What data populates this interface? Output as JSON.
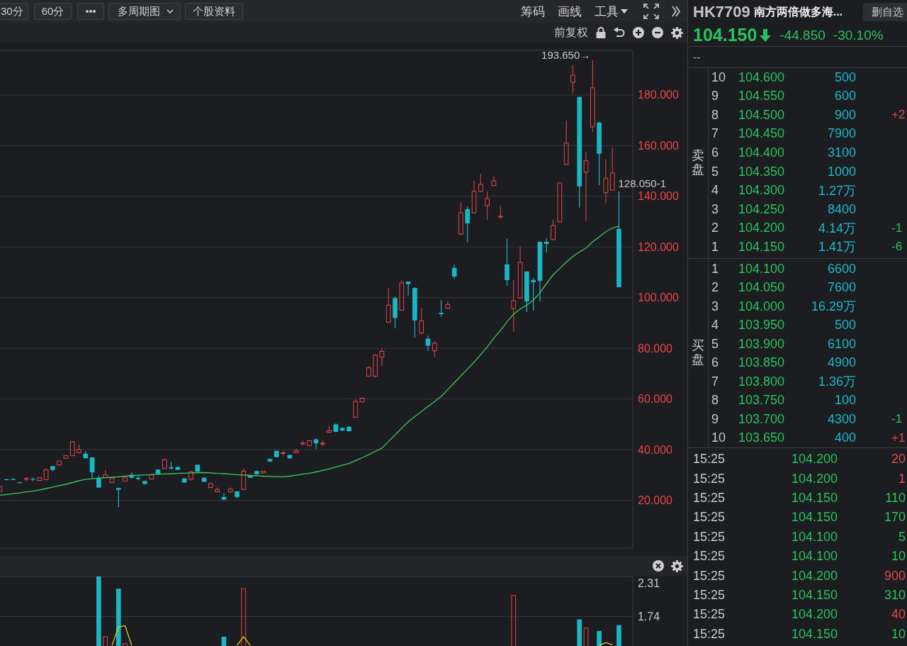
{
  "toolbar": {
    "left_buttons": [
      {
        "kind": "button",
        "label": "30分"
      },
      {
        "kind": "button",
        "label": "60分"
      },
      {
        "kind": "more"
      },
      {
        "kind": "dropdown",
        "label": "多周期图"
      },
      {
        "kind": "button",
        "label": "个股资料"
      }
    ],
    "right_items": [
      {
        "kind": "text",
        "label": "筹码"
      },
      {
        "kind": "text",
        "label": "画线"
      },
      {
        "kind": "menu",
        "label": "工具"
      }
    ]
  },
  "chart_toolbar": {
    "adjust_label": "前复权"
  },
  "chart": {
    "chart_data": [
      {
        "type": "candlestick",
        "ylim": [
          1.1,
          197.6
        ],
        "yticks": [
          {
            "value": 20,
            "label": "20.000"
          },
          {
            "value": 40,
            "label": "40.000"
          },
          {
            "value": 60,
            "label": "60.000"
          },
          {
            "value": 80,
            "label": "80.000"
          },
          {
            "value": 100,
            "label": "100.000"
          },
          {
            "value": 120,
            "label": "120.000"
          },
          {
            "value": 140,
            "label": "140.000"
          },
          {
            "value": 160,
            "label": "160.000"
          },
          {
            "value": 180,
            "label": "180.000"
          }
        ],
        "grid": true,
        "ohlc": [
          [
            23.6,
            25.6,
            23.4,
            25.4
          ],
          [
            28.3,
            28.5,
            27.9,
            28.0
          ],
          [
            28.4,
            28.6,
            28.0,
            28.1
          ],
          [
            27.1,
            27.3,
            26.8,
            27.0
          ],
          [
            28.3,
            29.1,
            27.6,
            28.6
          ],
          [
            28.4,
            29.1,
            27.5,
            28.1
          ],
          [
            27.8,
            29.0,
            27.6,
            28.9
          ],
          [
            28.1,
            32.4,
            28.0,
            32.1
          ],
          [
            33.5,
            33.6,
            31.5,
            32.0
          ],
          [
            33.9,
            35.6,
            33.8,
            35.5
          ],
          [
            36.5,
            37.8,
            36.3,
            37.6
          ],
          [
            37.6,
            43.3,
            37.5,
            43.1
          ],
          [
            38.8,
            42.0,
            38.6,
            40.0
          ],
          [
            38.4,
            39.5,
            36.5,
            36.6
          ],
          [
            36.9,
            37.0,
            28.8,
            31.0
          ],
          [
            28.8,
            29.8,
            24.8,
            25.0
          ],
          [
            29.0,
            32.0,
            28.8,
            30.0
          ],
          [
            27.0,
            29.0,
            26.8,
            28.8
          ],
          [
            24.8,
            25.0,
            17.3,
            24.1
          ],
          [
            27.5,
            29.2,
            27.4,
            29.1
          ],
          [
            30.1,
            31.0,
            28.5,
            28.9
          ],
          [
            28.9,
            29.8,
            27.9,
            28.4
          ],
          [
            27.6,
            27.8,
            26.2,
            26.4
          ],
          [
            28.4,
            30.4,
            28.2,
            30.0
          ],
          [
            32.1,
            32.3,
            30.0,
            30.3
          ],
          [
            32.5,
            36.3,
            32.3,
            36.0
          ],
          [
            33.0,
            35.1,
            32.2,
            32.6
          ],
          [
            33.1,
            33.5,
            31.9,
            32.0
          ],
          [
            28.6,
            28.9,
            26.9,
            27.0
          ],
          [
            28.3,
            31.5,
            27.9,
            31.3
          ],
          [
            34.0,
            34.2,
            31.0,
            31.3
          ],
          [
            28.9,
            29.0,
            27.1,
            27.3
          ],
          [
            25.0,
            26.9,
            24.9,
            26.6
          ],
          [
            23.3,
            25.0,
            23.1,
            24.3
          ],
          [
            21.3,
            22.8,
            20.0,
            20.3
          ],
          [
            23.3,
            25.0,
            23.1,
            24.4
          ],
          [
            23.5,
            23.6,
            20.8,
            21.3
          ],
          [
            24.3,
            32.5,
            24.0,
            31.5
          ],
          [
            29.8,
            30.0,
            28.8,
            28.9
          ],
          [
            31.5,
            31.8,
            30.1,
            30.3
          ],
          [
            30.8,
            31.6,
            30.6,
            31.5
          ],
          [
            36.3,
            36.5,
            35.1,
            35.3
          ],
          [
            39.5,
            39.6,
            36.9,
            37.0
          ],
          [
            38.5,
            39.5,
            37.5,
            38.8
          ],
          [
            37.9,
            38.0,
            36.4,
            36.6
          ],
          [
            38.8,
            40.3,
            38.6,
            39.5
          ],
          [
            42.4,
            43.5,
            41.6,
            42.6
          ],
          [
            41.6,
            43.8,
            41.4,
            43.5
          ],
          [
            44.0,
            44.5,
            40.3,
            42.5
          ],
          [
            42.3,
            43.5,
            41.3,
            42.5
          ],
          [
            46.8,
            49.3,
            46.6,
            47.5
          ],
          [
            50.0,
            50.3,
            46.9,
            47.0
          ],
          [
            48.5,
            48.8,
            47.3,
            47.5
          ],
          [
            49.0,
            49.3,
            47.0,
            47.3
          ],
          [
            52.8,
            59.8,
            52.5,
            59.0
          ],
          [
            58.8,
            60.5,
            58.6,
            60.3
          ],
          [
            69.0,
            73.0,
            68.8,
            72.3
          ],
          [
            69.0,
            77.8,
            68.5,
            77.3
          ],
          [
            76.5,
            80.0,
            73.0,
            78.8
          ],
          [
            90.3,
            103.8,
            90.0,
            97.0
          ],
          [
            99.8,
            100.5,
            87.9,
            92.0
          ],
          [
            95.0,
            107.0,
            94.8,
            105.8
          ],
          [
            106.3,
            106.5,
            100.8,
            105.3
          ],
          [
            103.8,
            104.0,
            84.3,
            91.0
          ],
          [
            86.0,
            96.0,
            85.8,
            90.8
          ],
          [
            83.8,
            85.0,
            79.0,
            81.0
          ],
          [
            79.0,
            82.9,
            76.4,
            82.0
          ],
          [
            94.0,
            99.0,
            92.5,
            93.5
          ],
          [
            95.8,
            98.5,
            95.6,
            97.3
          ],
          [
            111.7,
            113.0,
            107.5,
            108.3
          ],
          [
            125.1,
            137.7,
            124.5,
            133.5
          ],
          [
            134.9,
            136.0,
            121.8,
            129.3
          ],
          [
            133.5,
            146.1,
            133.3,
            141.9
          ],
          [
            141.9,
            148.9,
            141.7,
            144.7
          ],
          [
            136.3,
            141.9,
            130.7,
            139.1
          ],
          [
            144.2,
            148.0,
            144.0,
            146.1
          ],
          [
            131.8,
            136.3,
            131.3,
            132.1
          ],
          [
            113.1,
            123.2,
            104.7,
            106.9
          ],
          [
            95.7,
            106.9,
            86.5,
            98.8
          ],
          [
            99.9,
            120.1,
            99.5,
            113.9
          ],
          [
            110.3,
            110.5,
            94.3,
            98.5
          ],
          [
            106.9,
            107.8,
            94.9,
            106.1
          ],
          [
            122.0,
            122.2,
            98.5,
            106.6
          ],
          [
            122.0,
            123.4,
            117.8,
            121.2
          ],
          [
            122.9,
            130.7,
            122.7,
            128.5
          ],
          [
            129.9,
            145.6,
            129.7,
            145.3
          ],
          [
            152.6,
            169.9,
            152.4,
            161.0
          ],
          [
            185.0,
            191.8,
            180.8,
            187.8
          ],
          [
            179.2,
            179.5,
            135.5,
            143.9
          ],
          [
            149.5,
            157.6,
            130.2,
            154.0
          ],
          [
            167.4,
            193.65,
            165.4,
            182.8
          ],
          [
            169.1,
            169.3,
            144.4,
            156.8
          ],
          [
            141.4,
            154.5,
            137.2,
            147.0
          ],
          [
            142.5,
            159.3,
            142.3,
            149.2
          ],
          [
            127.1,
            141.9,
            104.15,
            104.15
          ]
        ],
        "series": [
          {
            "type": "line",
            "color": "#3ec95c",
            "values": [
              22.0,
              22.3,
              22.6,
              22.9,
              23.3,
              23.6,
              24.1,
              24.6,
              25.2,
              25.8,
              26.3,
              27.0,
              27.7,
              28.3,
              28.5,
              28.7,
              28.9,
              29.1,
              29.3,
              29.5,
              29.7,
              29.9,
              30.0,
              30.1,
              30.3,
              30.4,
              30.5,
              30.6,
              30.7,
              30.8,
              30.9,
              30.9,
              30.8,
              30.6,
              30.5,
              30.3,
              30.1,
              30.0,
              29.8,
              29.7,
              29.5,
              29.4,
              29.3,
              29.3,
              29.5,
              29.9,
              30.3,
              30.7,
              31.2,
              31.8,
              32.4,
              33.1,
              33.8,
              34.5,
              35.6,
              36.8,
              38.0,
              39.3,
              40.6,
              43.2,
              45.8,
              48.4,
              51.0,
              53.0,
              55.0,
              57.0,
              59.0,
              61.0,
              63.7,
              66.4,
              69.1,
              71.8,
              74.5,
              77.5,
              80.5,
              84.0,
              87.0,
              90.5,
              93.5,
              95.5,
              97.0,
              99.0,
              101.9,
              105.5,
              109.0,
              111.5,
              114.0,
              116.2,
              118.0,
              119.5,
              122.0,
              124.0,
              126.0,
              127.4,
              128.2
            ]
          }
        ],
        "annotations": [
          "193.650→",
          "128.050-1"
        ]
      },
      {
        "type": "bar",
        "categories": [
          null,
          null,
          null,
          null,
          null,
          null,
          null,
          null,
          null,
          null,
          null,
          null,
          null,
          null,
          null,
          null,
          null,
          null,
          null,
          null,
          null,
          null,
          null,
          null,
          null,
          null,
          null,
          null,
          null,
          null,
          null,
          null,
          null,
          null,
          null,
          null,
          null,
          null,
          null,
          null,
          null,
          null,
          null,
          null,
          null,
          null,
          null,
          null,
          null,
          null,
          null,
          null,
          null,
          null,
          null,
          null,
          null,
          null,
          null,
          null,
          null,
          null,
          null,
          null,
          null,
          null,
          null,
          null,
          null,
          null,
          null,
          null,
          null,
          null,
          null,
          null,
          null,
          null,
          null,
          null,
          null,
          null,
          null,
          null,
          null,
          null,
          null,
          null,
          null,
          null,
          null,
          null,
          null,
          null,
          null
        ],
        "ylim": [
          1.23,
          2.43
        ],
        "yticks": [
          {
            "value": 2.31,
            "label": "2.31"
          },
          {
            "value": 1.74,
            "label": "1.74"
          }
        ],
        "grid": true,
        "series": [
          {
            "color": "#1bb6c5",
            "values": [
              null,
              null,
              null,
              null,
              null,
              null,
              null,
              null,
              null,
              null,
              null,
              null,
              null,
              null,
              null,
              2.43,
              null,
              null,
              2.22,
              null,
              null,
              null,
              null,
              null,
              null,
              null,
              null,
              null,
              null,
              null,
              null,
              null,
              null,
              null,
              1.39,
              null,
              null,
              null,
              null,
              null,
              null,
              null,
              null,
              null,
              null,
              null,
              null,
              null,
              null,
              null,
              null,
              null,
              null,
              null,
              null,
              null,
              null,
              null,
              null,
              null,
              null,
              null,
              null,
              null,
              null,
              null,
              null,
              null,
              null,
              null,
              null,
              null,
              null,
              null,
              null,
              null,
              null,
              null,
              null,
              null,
              null,
              null,
              null,
              null,
              null,
              null,
              null,
              null,
              1.69,
              null,
              null,
              1.49,
              null,
              null,
              1.59
            ]
          },
          {
            "color": "#e8464a",
            "values": [
              null,
              null,
              null,
              null,
              null,
              null,
              null,
              null,
              null,
              null,
              null,
              null,
              null,
              null,
              null,
              null,
              1.39,
              null,
              null,
              1.27,
              null,
              null,
              null,
              null,
              null,
              null,
              null,
              null,
              null,
              null,
              null,
              null,
              null,
              null,
              null,
              null,
              null,
              2.22,
              null,
              null,
              null,
              null,
              null,
              null,
              null,
              null,
              null,
              null,
              null,
              null,
              null,
              null,
              null,
              null,
              null,
              null,
              null,
              null,
              null,
              null,
              null,
              null,
              null,
              null,
              null,
              null,
              null,
              null,
              null,
              null,
              null,
              null,
              null,
              null,
              null,
              null,
              null,
              null,
              2.1,
              null,
              null,
              null,
              null,
              null,
              null,
              null,
              null,
              null,
              null,
              1.54,
              null,
              null,
              null,
              null,
              null
            ]
          },
          {
            "type": "line",
            "color": "#e3c81a",
            "values": [
              null,
              null,
              null,
              null,
              null,
              null,
              null,
              null,
              null,
              null,
              null,
              null,
              null,
              null,
              null,
              null,
              null,
              1.24,
              1.56,
              1.58,
              1.24,
              null,
              null,
              null,
              null,
              null,
              null,
              null,
              null,
              null,
              null,
              null,
              null,
              null,
              null,
              null,
              1.24,
              1.39,
              1.24,
              null,
              null,
              null,
              null,
              null,
              null,
              null,
              null,
              null,
              null,
              null,
              null,
              null,
              null,
              null,
              null,
              null,
              null,
              null,
              null,
              null,
              null,
              null,
              null,
              null,
              null,
              null,
              null,
              null,
              null,
              null,
              null,
              null,
              null,
              null,
              null,
              null,
              null,
              null,
              null,
              null,
              null,
              null,
              null,
              null,
              null,
              null,
              null,
              null,
              null,
              null,
              null,
              1.24,
              1.29,
              1.25,
              null
            ]
          }
        ]
      }
    ]
  },
  "quote": {
    "code": "HK7709",
    "name": "南方两倍做多海...",
    "action_button": "删自选",
    "price": "104.150",
    "falling": true,
    "change": "-44.850",
    "change_percent": "-30.10%",
    "note": "--"
  },
  "order_book": {
    "sell_label": "卖盘",
    "sell": [
      {
        "level": "10",
        "price": "104.600",
        "volume": "500"
      },
      {
        "level": "9",
        "price": "104.550",
        "volume": "600"
      },
      {
        "level": "8",
        "price": "104.500",
        "volume": "900",
        "change": "+2",
        "color": "#e8464a"
      },
      {
        "level": "7",
        "price": "104.450",
        "volume": "7900"
      },
      {
        "level": "6",
        "price": "104.400",
        "volume": "3100"
      },
      {
        "level": "5",
        "price": "104.350",
        "volume": "1000"
      },
      {
        "level": "4",
        "price": "104.300",
        "volume": "1.27万"
      },
      {
        "level": "3",
        "price": "104.250",
        "volume": "8400"
      },
      {
        "level": "2",
        "price": "104.200",
        "volume": "4.14万",
        "change": "-1",
        "color": "#2bc25e"
      },
      {
        "level": "1",
        "price": "104.150",
        "volume": "1.41万",
        "change": "-6",
        "color": "#2bc25e"
      }
    ],
    "buy_label": "买盘",
    "buy": [
      {
        "level": "1",
        "price": "104.100",
        "volume": "6600"
      },
      {
        "level": "2",
        "price": "104.050",
        "volume": "7600"
      },
      {
        "level": "3",
        "price": "104.000",
        "volume": "16.29万"
      },
      {
        "level": "4",
        "price": "103.950",
        "volume": "500"
      },
      {
        "level": "5",
        "price": "103.900",
        "volume": "6100"
      },
      {
        "level": "6",
        "price": "103.850",
        "volume": "4900"
      },
      {
        "level": "7",
        "price": "103.800",
        "volume": "1.36万"
      },
      {
        "level": "8",
        "price": "103.750",
        "volume": "100"
      },
      {
        "level": "9",
        "price": "103.700",
        "volume": "4300",
        "change": "-1",
        "color": "#2bc25e"
      },
      {
        "level": "10",
        "price": "103.650",
        "volume": "400",
        "change": "+1",
        "color": "#e8464a"
      }
    ]
  },
  "trades": [
    {
      "time": "15:25",
      "price": "104.200",
      "volume": "20",
      "color": "#e0494d"
    },
    {
      "time": "15:25",
      "price": "104.200",
      "volume": "1",
      "color": "#e0494d"
    },
    {
      "time": "15:25",
      "price": "104.150",
      "volume": "110",
      "color": "#2bc25e"
    },
    {
      "time": "15:25",
      "price": "104.150",
      "volume": "170",
      "color": "#2bc25e"
    },
    {
      "time": "15:25",
      "price": "104.100",
      "volume": "5",
      "color": "#2bc25e"
    },
    {
      "time": "15:25",
      "price": "104.100",
      "volume": "10",
      "color": "#2bc25e"
    },
    {
      "time": "15:25",
      "price": "104.200",
      "volume": "900",
      "color": "#e0494d"
    },
    {
      "time": "15:25",
      "price": "104.150",
      "volume": "310",
      "color": "#2bc25e"
    },
    {
      "time": "15:25",
      "price": "104.200",
      "volume": "40",
      "color": "#e0494d"
    },
    {
      "time": "15:25",
      "price": "104.150",
      "volume": "10",
      "color": "#2bc25e"
    }
  ]
}
